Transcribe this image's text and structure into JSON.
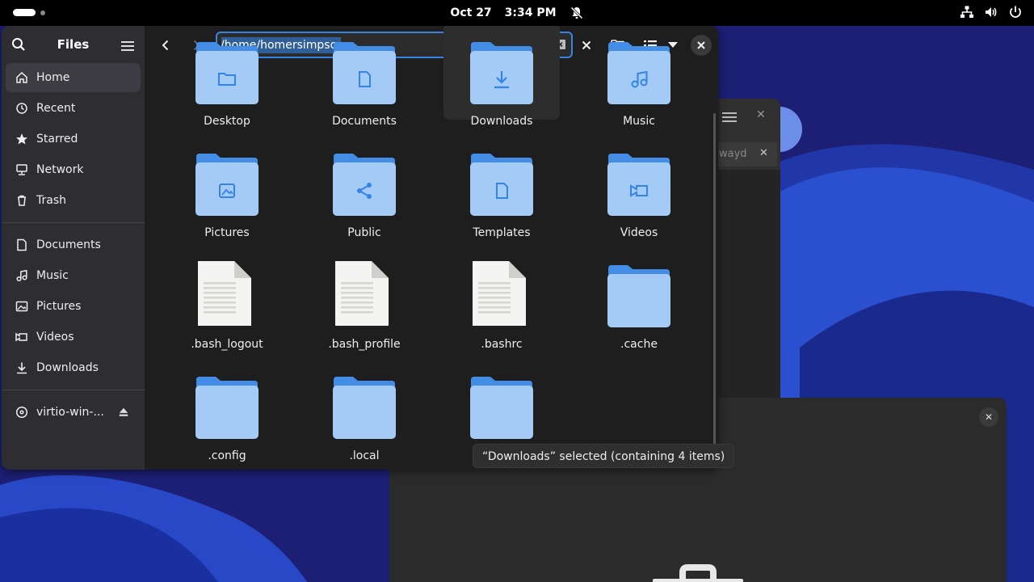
{
  "topbar": {
    "date": "Oct 27",
    "time": "3:34 PM",
    "icons": [
      "notifications-off-icon",
      "network-wired-icon",
      "volume-icon",
      "power-icon"
    ]
  },
  "sidebar": {
    "title": "Files",
    "places": [
      {
        "label": "Home",
        "icon": "home-icon",
        "active": true
      },
      {
        "label": "Recent",
        "icon": "clock-icon"
      },
      {
        "label": "Starred",
        "icon": "star-icon"
      },
      {
        "label": "Network",
        "icon": "network-icon"
      },
      {
        "label": "Trash",
        "icon": "trash-icon"
      }
    ],
    "bookmarks": [
      {
        "label": "Documents",
        "icon": "document-icon"
      },
      {
        "label": "Music",
        "icon": "music-icon"
      },
      {
        "label": "Pictures",
        "icon": "picture-icon"
      },
      {
        "label": "Videos",
        "icon": "video-icon"
      },
      {
        "label": "Downloads",
        "icon": "download-icon"
      }
    ],
    "devices": [
      {
        "label": "virtio-win-...",
        "icon": "disc-icon"
      }
    ]
  },
  "toolbar": {
    "path": "/home/homersimpson"
  },
  "files": [
    {
      "name": "Desktop",
      "type": "folder",
      "emblem": "folder"
    },
    {
      "name": "Documents",
      "type": "folder",
      "emblem": "document"
    },
    {
      "name": "Downloads",
      "type": "folder",
      "emblem": "download",
      "selected": true
    },
    {
      "name": "Music",
      "type": "folder",
      "emblem": "music"
    },
    {
      "name": "Pictures",
      "type": "folder",
      "emblem": "picture"
    },
    {
      "name": "Public",
      "type": "folder",
      "emblem": "share"
    },
    {
      "name": "Templates",
      "type": "folder",
      "emblem": "template"
    },
    {
      "name": "Videos",
      "type": "folder",
      "emblem": "video"
    },
    {
      "name": ".bash_logout",
      "type": "text"
    },
    {
      "name": ".bash_profile",
      "type": "text"
    },
    {
      "name": ".bashrc",
      "type": "text"
    },
    {
      "name": ".cache",
      "type": "folder"
    },
    {
      "name": ".config",
      "type": "folder"
    },
    {
      "name": ".local",
      "type": "folder"
    },
    {
      "name": "",
      "type": "folder"
    }
  ],
  "status": {
    "text": "“Downloads” selected  (containing 4 items)"
  },
  "background_window": {
    "tab_text": "wayd"
  },
  "colors": {
    "accent": "#3584e4",
    "folder_body": "#a4caf6",
    "folder_tab": "#438de6",
    "emblem": "#3584e4"
  }
}
